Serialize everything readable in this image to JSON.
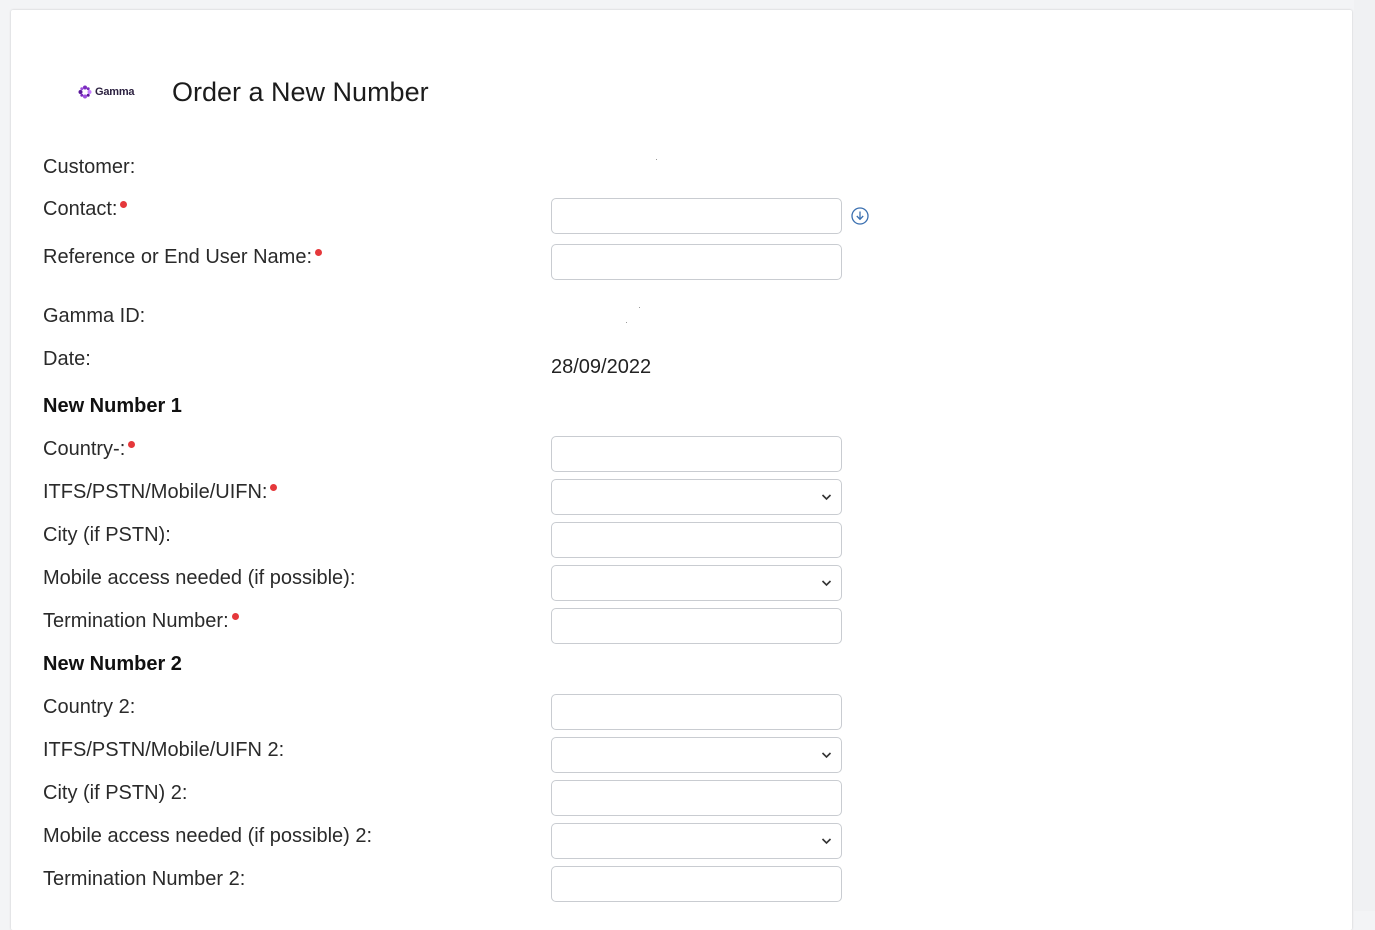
{
  "header": {
    "logo_text": "Gamma",
    "title": "Order a New Number"
  },
  "form": {
    "customer_label": "Customer:",
    "contact_label": "Contact:",
    "contact_value": "",
    "reference_label": "Reference or End User Name:",
    "reference_value": "",
    "gamma_id_label": "Gamma ID:",
    "date_label": "Date:",
    "date_value": "28/09/2022",
    "section1_title": "New Number 1",
    "country1_label": "Country-:",
    "country1_value": "",
    "type1_label": "ITFS/PSTN/Mobile/UIFN:",
    "type1_value": "",
    "city1_label": "City (if PSTN):",
    "city1_value": "",
    "mobile1_label": "Mobile access needed (if possible):",
    "mobile1_value": "",
    "termination1_label": "Termination Number:",
    "termination1_value": "",
    "section2_title": "New Number 2",
    "country2_label": "Country 2:",
    "country2_value": "",
    "type2_label": "ITFS/PSTN/Mobile/UIFN 2:",
    "type2_value": "",
    "city2_label": "City (if PSTN) 2:",
    "city2_value": "",
    "mobile2_label": "Mobile access needed (if possible) 2:",
    "mobile2_value": "",
    "termination2_label": "Termination Number 2:",
    "termination2_value": ""
  },
  "icons": {
    "lookup": "arrow-down-circle-icon",
    "dropdown": "chevron-down-icon",
    "required": "required-dot-icon"
  },
  "colors": {
    "required": "#e5383b",
    "logo_accent": "#7b2cbf",
    "lookup_icon": "#3a6fb0"
  }
}
